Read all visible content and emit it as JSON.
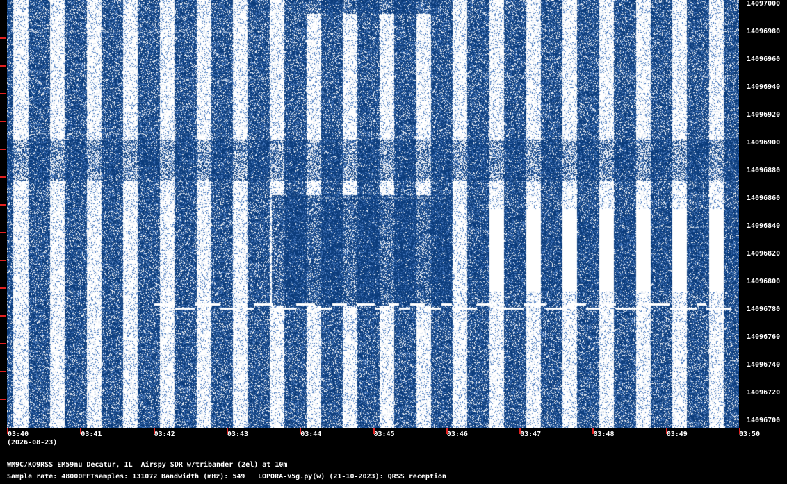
{
  "colors": {
    "background": "#000000",
    "waterfall_bg": "#0b3c7c",
    "signal": "#ffffff",
    "tick": "#e02020"
  },
  "y_axis": {
    "labels": [
      "14097000",
      "14096980",
      "14096960",
      "14096940",
      "14096920",
      "14096900",
      "14096880",
      "14096860",
      "14096840",
      "14096820",
      "14096800",
      "14096780",
      "14096760",
      "14096740",
      "14096720",
      "14096700"
    ]
  },
  "x_axis": {
    "labels": [
      "03:40",
      "03:41",
      "03:42",
      "03:43",
      "03:44",
      "03:45",
      "03:46",
      "03:47",
      "03:48",
      "03:49",
      "03:50"
    ],
    "date": "(2026-08-23)"
  },
  "footer": {
    "station": "WM9C/KQ9RSS EM59nu Decatur, IL  Airspy SDR w/tribander (2el) at 10m",
    "sample_rate": "Sample rate: 48000",
    "fft_samples": "FFTsamples: 131072",
    "bandwidth": "Bandwidth (mHz): 549",
    "software": "LOPORA-v5g.py(w) (21-10-2023): QRSS reception"
  }
}
